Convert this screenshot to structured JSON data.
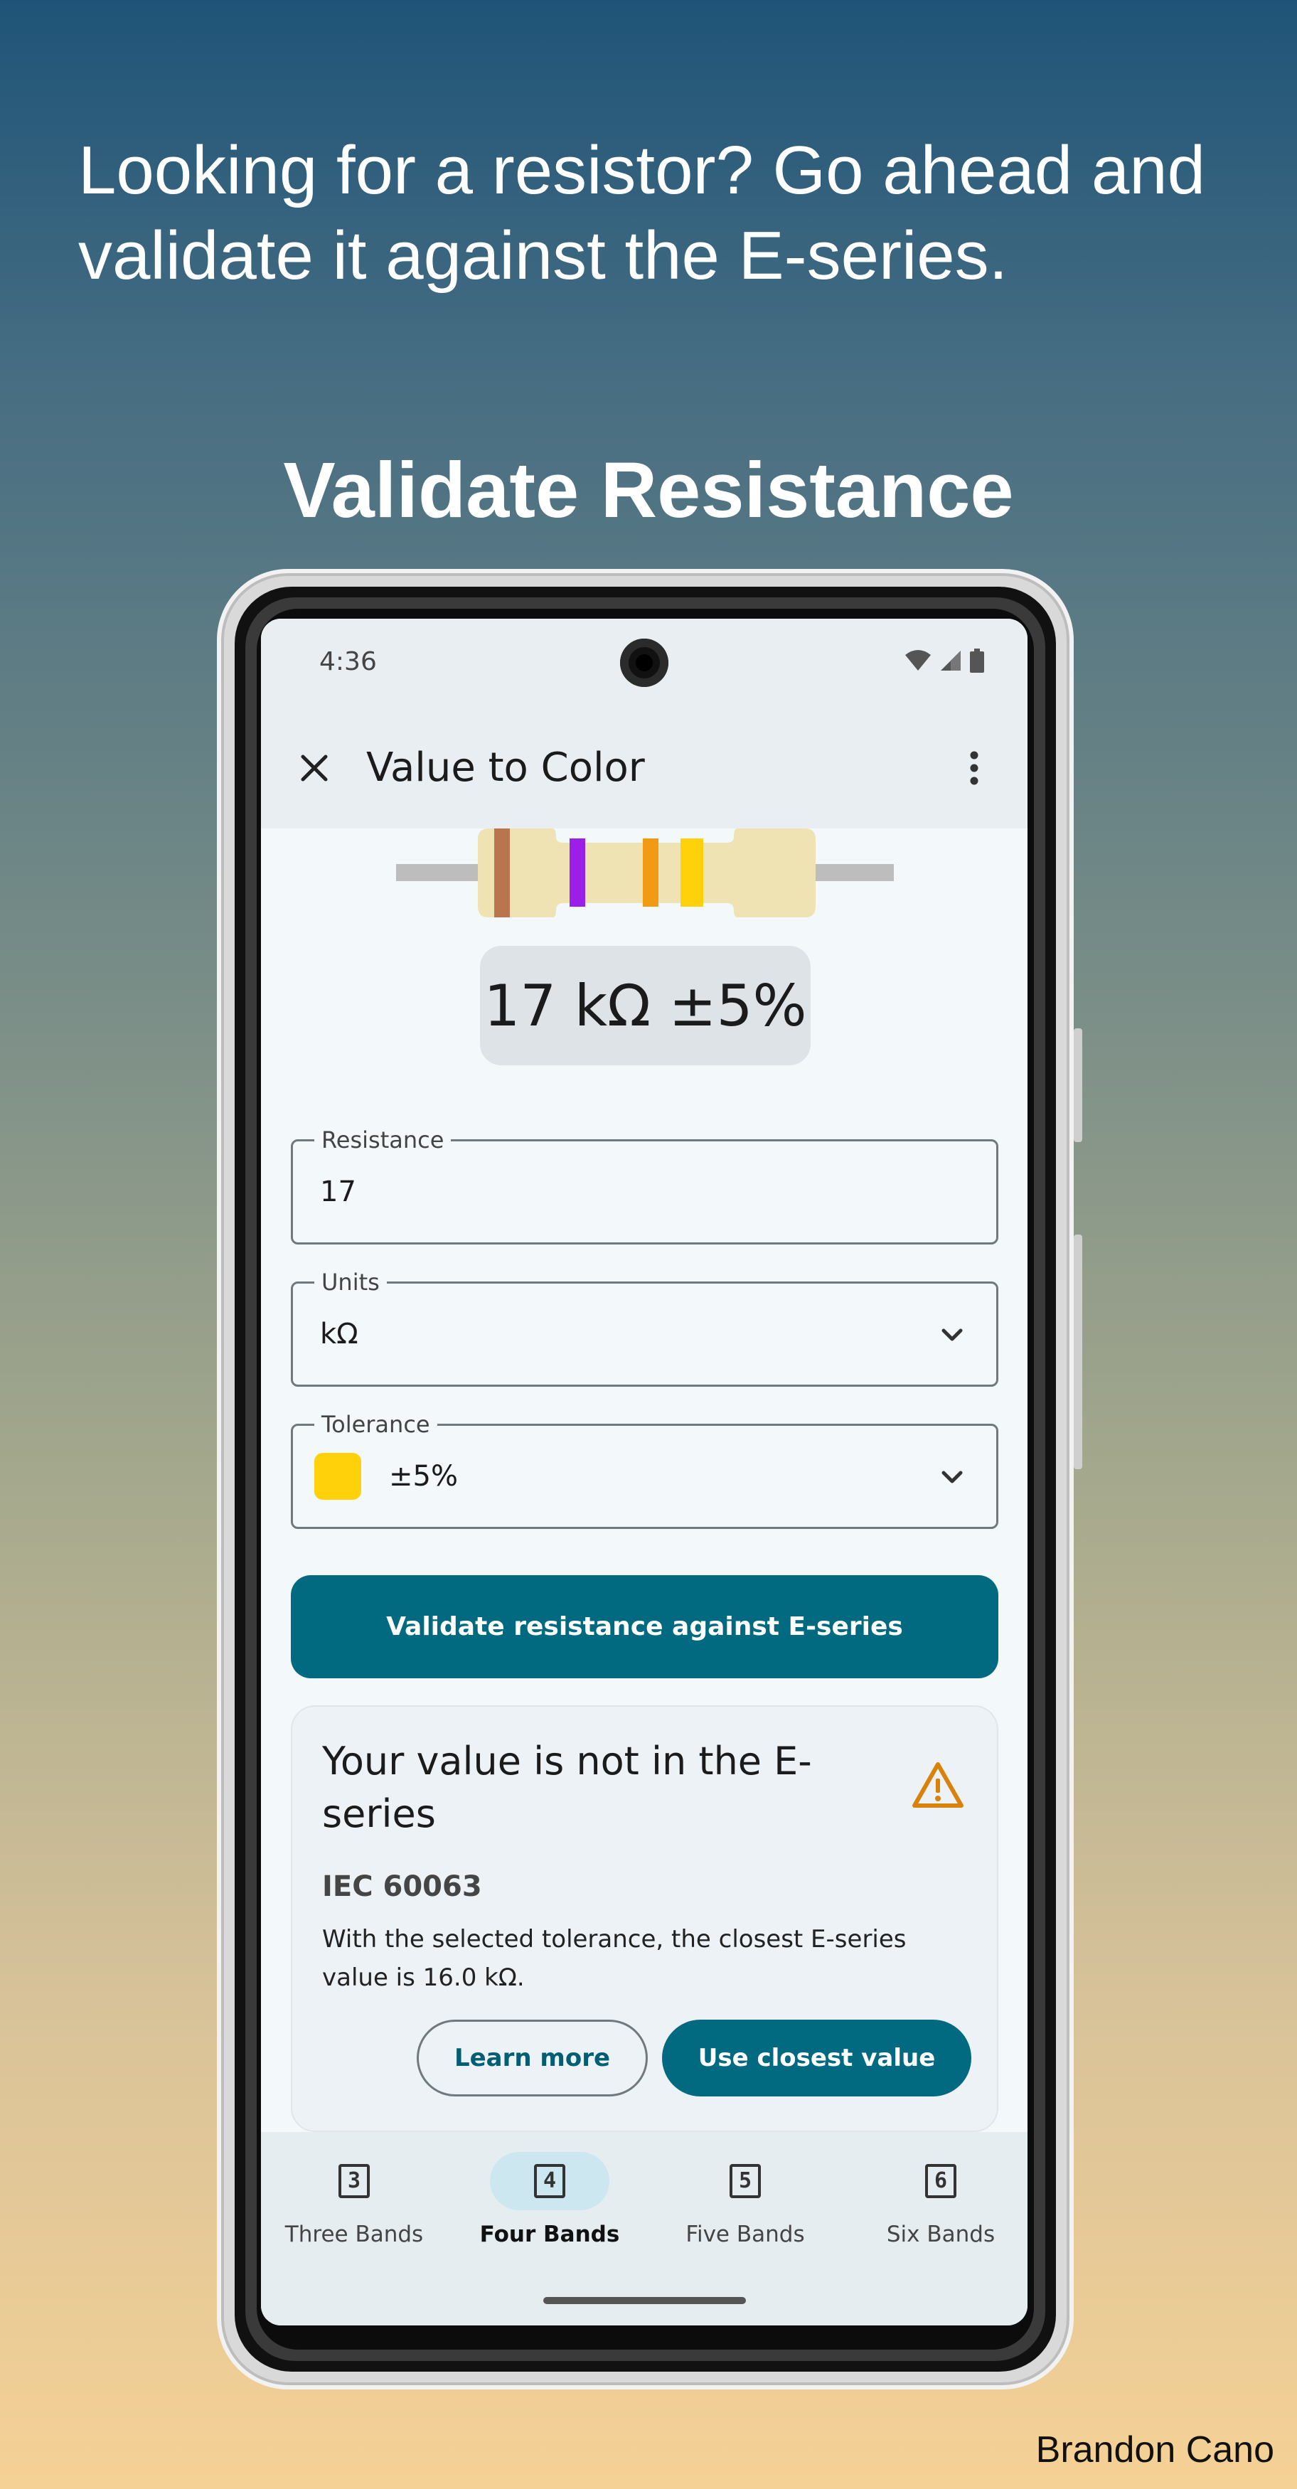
{
  "promo": {
    "tagline": "Looking for a resistor? Go ahead and validate it against the E-series.",
    "headline": "Validate Resistance",
    "credit": "Brandon Cano"
  },
  "status_bar": {
    "time": "4:36",
    "icons": [
      "wifi-icon",
      "signal-icon",
      "battery-icon"
    ]
  },
  "app_bar": {
    "title": "Value to Color",
    "close_icon": "close-icon",
    "menu_icon": "more-vert-icon"
  },
  "resistor": {
    "body_color": "#efe3b4",
    "lead_color": "#bdbdbd",
    "bands": [
      {
        "name": "brown",
        "color": "#b9764e"
      },
      {
        "name": "violet",
        "color": "#9b1fe8"
      },
      {
        "name": "orange",
        "color": "#f39a14"
      },
      {
        "name": "gold",
        "color": "#ffd10a"
      }
    ]
  },
  "value_display": "17 kΩ ±5%",
  "fields": {
    "resistance": {
      "label": "Resistance",
      "value": "17"
    },
    "units": {
      "label": "Units",
      "value": "kΩ"
    },
    "tolerance": {
      "label": "Tolerance",
      "value": "±5%",
      "swatch_color": "#ffd10a"
    }
  },
  "primary_button": "Validate resistance against E-series",
  "result_card": {
    "title": "Your value is not in the E-series",
    "subtitle": "IEC 60063",
    "body": "With the selected tolerance, the closest E-series value is 16.0 kΩ.",
    "learn_more": "Learn more",
    "use_closest": "Use closest value",
    "warning_color": "#d9820b"
  },
  "bottom_nav": [
    {
      "digit": "3",
      "label": "Three Bands",
      "active": false
    },
    {
      "digit": "4",
      "label": "Four Bands",
      "active": true
    },
    {
      "digit": "5",
      "label": "Five Bands",
      "active": false
    },
    {
      "digit": "6",
      "label": "Six Bands",
      "active": false
    }
  ],
  "colors": {
    "primary": "#026a80",
    "surface": "#f3f8fb",
    "app_bar": "#e8eef1"
  }
}
